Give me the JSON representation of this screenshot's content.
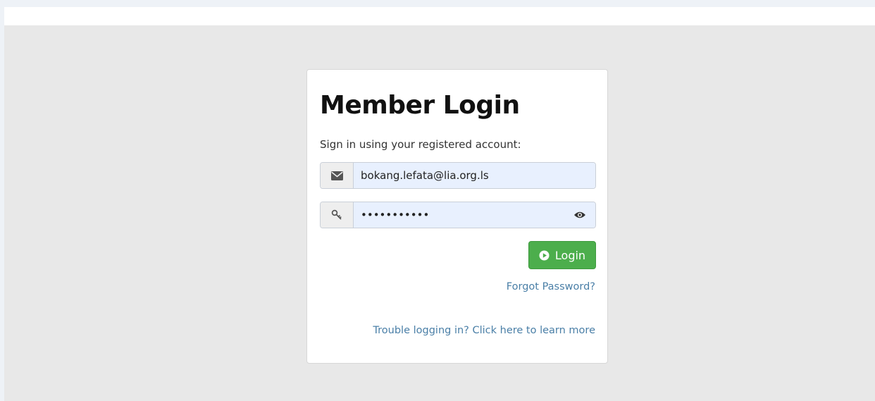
{
  "login": {
    "title": "Member Login",
    "subtitle": "Sign in using your registered account:",
    "email": {
      "value": "bokang.lefata@lia.org.ls",
      "icon": "envelope-icon"
    },
    "password": {
      "value": "passwordxyz",
      "icon": "key-icon",
      "toggle_icon": "eye-icon"
    },
    "button": {
      "label": "Login",
      "icon": "play-circle-icon",
      "color": "#4cae4c"
    },
    "forgot_label": "Forgot Password?",
    "trouble_label": "Trouble logging in? Click here to learn more"
  },
  "colors": {
    "link": "#4a7fa7",
    "field_background": "#e8f0fe",
    "page_background": "#e8e8e8"
  }
}
